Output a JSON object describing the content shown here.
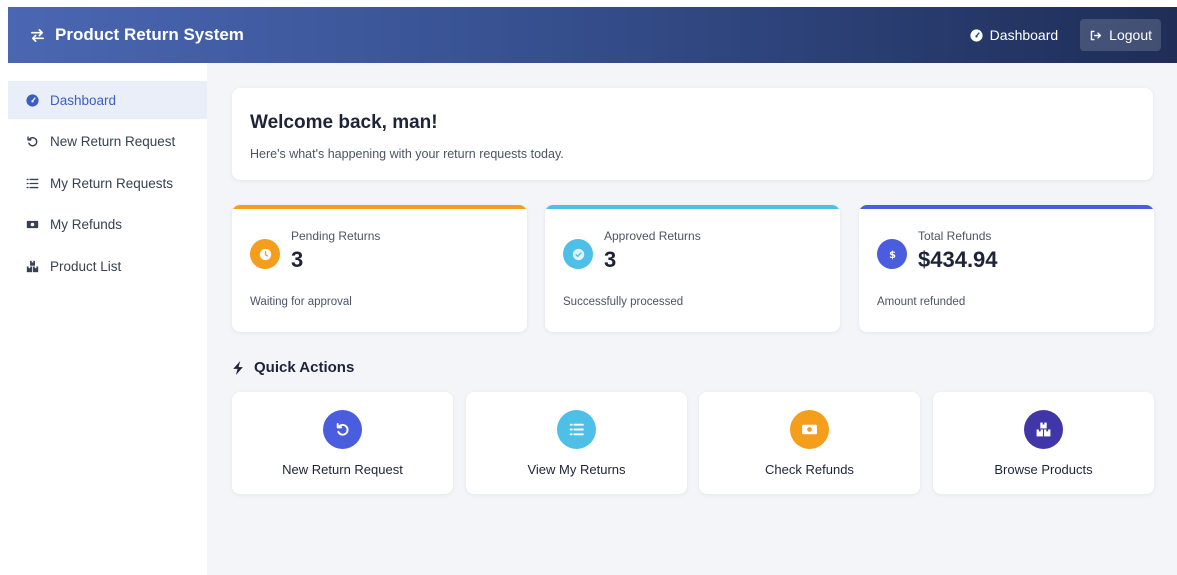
{
  "header": {
    "title": "Product Return System",
    "dashboard_label": "Dashboard",
    "logout_label": "Logout"
  },
  "sidebar": {
    "items": [
      {
        "label": "Dashboard",
        "icon": "dashboard-icon",
        "active": true
      },
      {
        "label": "New Return Request",
        "icon": "undo-icon"
      },
      {
        "label": "My Return Requests",
        "icon": "list-icon"
      },
      {
        "label": "My Refunds",
        "icon": "money-icon"
      },
      {
        "label": "Product List",
        "icon": "boxes-icon"
      }
    ]
  },
  "welcome": {
    "title": "Welcome back, man!",
    "subtitle": "Here's what's happening with your return requests today."
  },
  "stats": [
    {
      "label": "Pending Returns",
      "value": "3",
      "note": "Waiting for approval",
      "color": "#f59e1b",
      "icon": "clock-icon"
    },
    {
      "label": "Approved Returns",
      "value": "3",
      "note": "Successfully processed",
      "color": "#4ec0e8",
      "icon": "check-icon"
    },
    {
      "label": "Total Refunds",
      "value": "$434.94",
      "note": "Amount refunded",
      "color": "#4a5ddf",
      "icon": "dollar-icon"
    }
  ],
  "quick_actions": {
    "title": "Quick Actions",
    "items": [
      {
        "label": "New Return Request",
        "color": "#4a5ddf",
        "icon": "undo-icon"
      },
      {
        "label": "View My Returns",
        "color": "#4ec0e8",
        "icon": "list-icon"
      },
      {
        "label": "Check Refunds",
        "color": "#f59e1b",
        "icon": "money-icon"
      },
      {
        "label": "Browse Products",
        "color": "#4136a8",
        "icon": "boxes-icon"
      }
    ]
  },
  "colors": {
    "header_start": "#4b67b3",
    "header_end": "#1f2d57",
    "sidebar_active_bg": "#e9eef9",
    "sidebar_active_text": "#3b5fc0",
    "main_bg": "#f3f5f9"
  }
}
